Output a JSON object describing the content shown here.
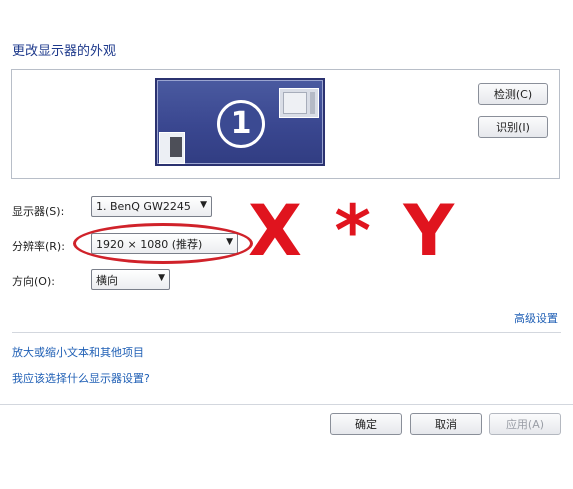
{
  "header": {
    "title": "更改显示器的外观"
  },
  "preview": {
    "monitor_number": "1",
    "detect_label": "检测(C)",
    "identify_label": "识别(I)"
  },
  "settings": {
    "display_label": "显示器(S):",
    "display_value": "1. BenQ GW2245",
    "resolution_label": "分辨率(R):",
    "resolution_value": "1920 × 1080 (推荐)",
    "orientation_label": "方向(O):",
    "orientation_value": "横向"
  },
  "annotation": {
    "text": "X * Y",
    "color": "#e0141e"
  },
  "links": {
    "advanced": "高级设置",
    "enlarge_text": "放大或缩小文本和其他项目",
    "choose_settings": "我应该选择什么显示器设置?"
  },
  "footer": {
    "ok_label": "确定",
    "cancel_label": "取消",
    "apply_label": "应用(A)"
  },
  "colors": {
    "link": "#1f5fb5",
    "monitor": "#3a4790",
    "annotation": "#d0222a"
  }
}
